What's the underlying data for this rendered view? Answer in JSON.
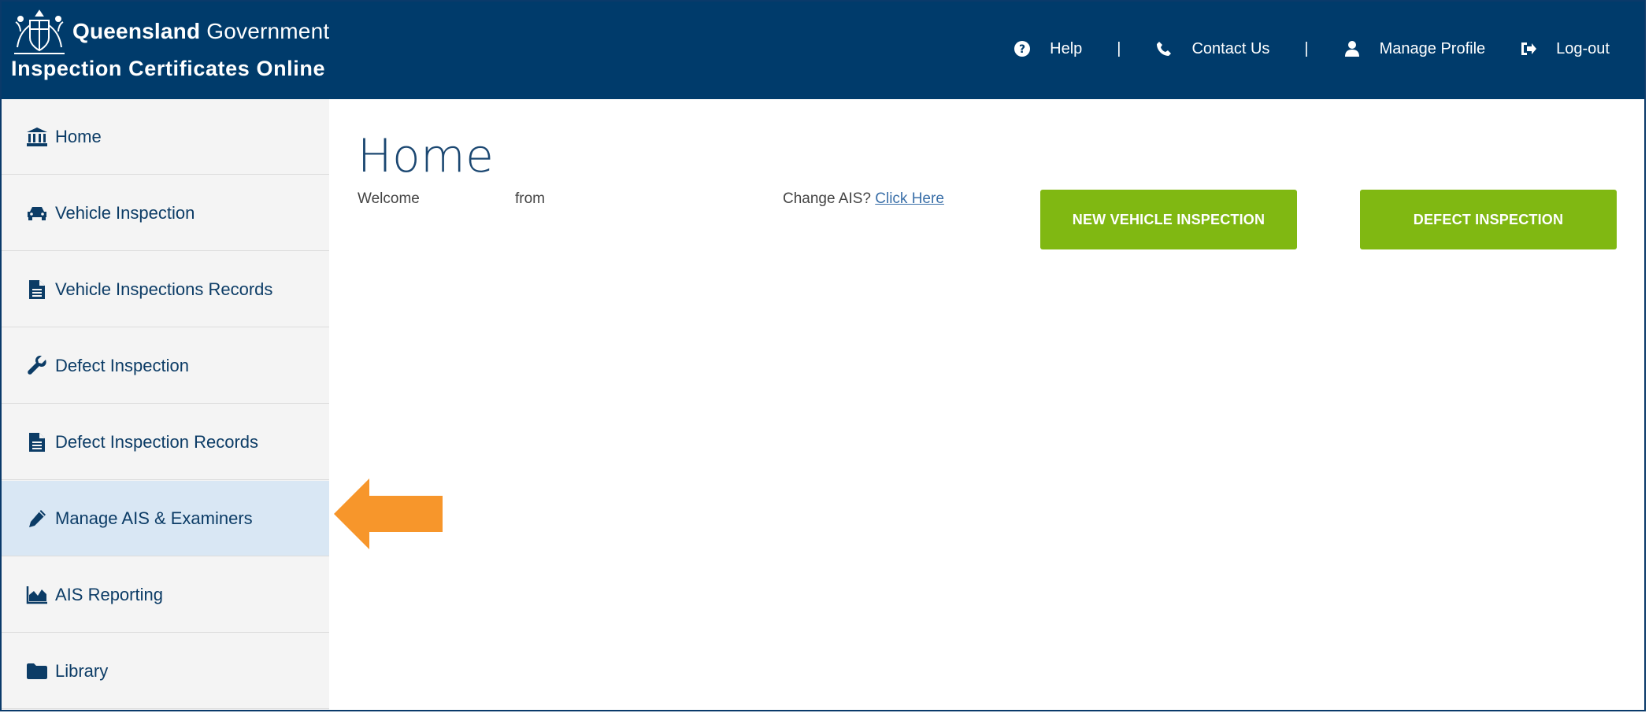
{
  "header": {
    "brand_bold": "Queensland",
    "brand_light": "Government",
    "app_title": "Inspection Certificates Online",
    "nav": [
      {
        "label": "Help",
        "icon": "question-circle-icon"
      },
      {
        "label": "Contact Us",
        "icon": "phone-icon"
      },
      {
        "label": "Manage Profile",
        "icon": "user-icon"
      },
      {
        "label": "Log-out",
        "icon": "logout-icon"
      }
    ],
    "separator": "|"
  },
  "sidebar": {
    "active_index": 5,
    "items": [
      {
        "label": "Home",
        "icon": "bank-icon"
      },
      {
        "label": "Vehicle Inspection",
        "icon": "car-icon"
      },
      {
        "label": "Vehicle Inspections Records",
        "icon": "document-icon"
      },
      {
        "label": "Defect Inspection",
        "icon": "wrench-icon"
      },
      {
        "label": "Defect Inspection Records",
        "icon": "document-icon"
      },
      {
        "label": "Manage AIS & Examiners",
        "icon": "pencil-icon"
      },
      {
        "label": "AIS Reporting",
        "icon": "area-chart-icon"
      },
      {
        "label": "Library",
        "icon": "folder-icon"
      }
    ]
  },
  "main": {
    "title": "Home",
    "welcome": "Welcome",
    "from": "from",
    "change_ais_prompt": "Change AIS?",
    "change_ais_link": "Click Here",
    "buttons": {
      "new_vehicle": "NEW VEHICLE INSPECTION",
      "defect": "DEFECT INSPECTION"
    }
  },
  "colors": {
    "header_bg": "#003b6b",
    "accent_green": "#80b812",
    "arrow": "#f7962b",
    "active_bg": "#d9e7f4",
    "nav_text": "#0c3c66"
  }
}
